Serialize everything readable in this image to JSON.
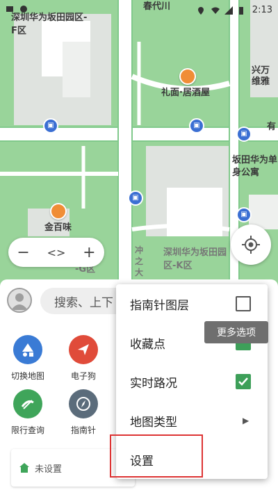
{
  "status_bar": {
    "time": "2:13",
    "icons": [
      "notification-icon",
      "location-icon",
      "wifi-icon",
      "signal-icon",
      "battery-icon"
    ]
  },
  "map": {
    "labels": {
      "top_left": "深圳华为坂田园区-F区",
      "top_partial": "春代川",
      "right_top": "兴万 维雅",
      "liyuan": "礼面·居酒屋",
      "you": "有",
      "bantian_single": "坂田华为单身公寓",
      "jinbaiwei": "金百味",
      "k_zone": "深圳华为坂田园区-K区",
      "ruins": "冲之大",
      "g_zone": "-G区"
    },
    "colors": {
      "park": "#99d49a",
      "road": "#ffffff",
      "road_edge": "#80c98b",
      "block": "#dfe3df",
      "building": "#ffffff"
    }
  },
  "map_controls": {
    "zoom_out": "−",
    "pan": "<>",
    "zoom_in": "+"
  },
  "bottom_panel": {
    "search_placeholder": "搜索、上下",
    "grid": [
      {
        "label": "切换地图",
        "icon": "switch-map-icon",
        "color": "#3a7bd5"
      },
      {
        "label": "电子狗",
        "icon": "radar-icon",
        "color": "#e04b3a"
      },
      {
        "label": "限行查询",
        "icon": "restriction-icon",
        "color": "#3fa55a"
      },
      {
        "label": "指南针",
        "icon": "compass-icon",
        "color": "#5b6c7b"
      }
    ],
    "home_label": "未设置"
  },
  "menu": {
    "items": [
      {
        "label": "指南针图层",
        "control": "checkbox",
        "checked": false
      },
      {
        "label": "收藏点",
        "control": "checkbox",
        "checked": true
      },
      {
        "label": "实时路况",
        "control": "checkbox",
        "checked": true
      },
      {
        "label": "地图类型",
        "control": "submenu"
      },
      {
        "label": "设置",
        "control": "none"
      }
    ]
  },
  "tooltip": "更多选项"
}
